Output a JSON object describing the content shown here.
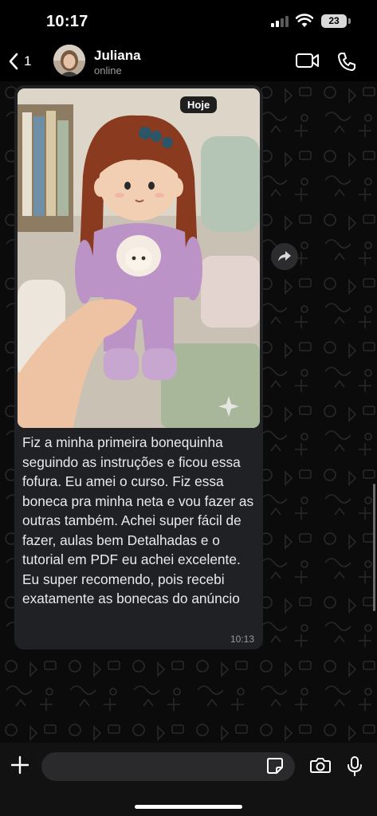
{
  "status_bar": {
    "time": "10:17",
    "battery": "23",
    "icons": [
      "signal-icon",
      "wifi-icon",
      "battery-icon"
    ]
  },
  "header": {
    "back_count": "1",
    "contact_name": "Juliana",
    "contact_status": "online",
    "icons": [
      "chevron-left-icon",
      "video-camera-icon",
      "phone-icon"
    ]
  },
  "chat": {
    "date_chip": "Hoje",
    "message": {
      "text": "Fiz a minha primeira bonequinha seguindo as instruções e ficou essa fofura. Eu amei o curso. Fiz essa boneca pra minha neta e vou fazer as outras também. Achei super fácil de fazer, aulas bem Detalhadas e o tutorial em PDF eu achei excelente. Eu super recomendo, pois recebi exatamente as bonecas do anúncio",
      "time": "10:13",
      "photo_icon": "doll-photo"
    },
    "forward_icon": "forward-icon"
  },
  "input_bar": {
    "icons": [
      "plus-icon",
      "sticker-icon",
      "camera-icon",
      "microphone-icon"
    ]
  },
  "colors": {
    "background": "#000000",
    "bubble": "#202124",
    "secondary_text": "#9a9a9a",
    "input_field": "#2a2a2c"
  }
}
